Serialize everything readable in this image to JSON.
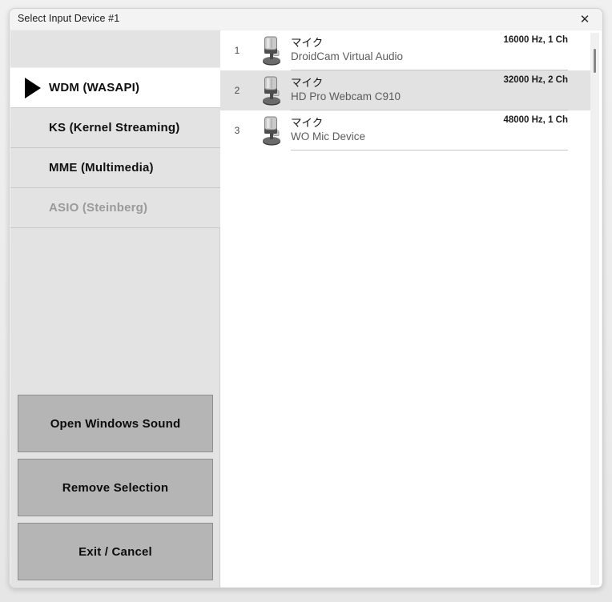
{
  "window": {
    "title": "Select Input Device #1",
    "close_icon": "close-icon",
    "close_glyph": "✕"
  },
  "sidebar": {
    "api_items": [
      {
        "label": "WDM (WASAPI)",
        "selected": true,
        "disabled": false
      },
      {
        "label": "KS (Kernel Streaming)",
        "selected": false,
        "disabled": false
      },
      {
        "label": "MME (Multimedia)",
        "selected": false,
        "disabled": false
      },
      {
        "label": "ASIO (Steinberg)",
        "selected": false,
        "disabled": true
      }
    ],
    "buttons": [
      {
        "label": "Open Windows Sound",
        "name": "open-windows-sound-button"
      },
      {
        "label": "Remove Selection",
        "name": "remove-selection-button"
      },
      {
        "label": "Exit / Cancel",
        "name": "exit-cancel-button"
      }
    ]
  },
  "devices": [
    {
      "index": "1",
      "title": "マイク",
      "name": "DroidCam Virtual Audio",
      "format": "16000 Hz, 1 Ch",
      "selected": false,
      "icon": "microphone-icon"
    },
    {
      "index": "2",
      "title": "マイク",
      "name": "HD Pro Webcam C910",
      "format": "32000 Hz, 2 Ch",
      "selected": true,
      "icon": "microphone-icon"
    },
    {
      "index": "3",
      "title": "マイク",
      "name": "WO Mic Device",
      "format": "48000 Hz, 1 Ch",
      "selected": false,
      "icon": "microphone-icon"
    }
  ],
  "colors": {
    "sidebar_bg": "#e3e3e3",
    "selected_api_bg": "#ffffff",
    "selected_row_bg": "#e2e2e2",
    "button_bg": "#b5b5b5",
    "list_bg": "#ffffff",
    "marker": "#000000"
  },
  "scrollbar": {
    "name": "device-list-scrollbar"
  }
}
